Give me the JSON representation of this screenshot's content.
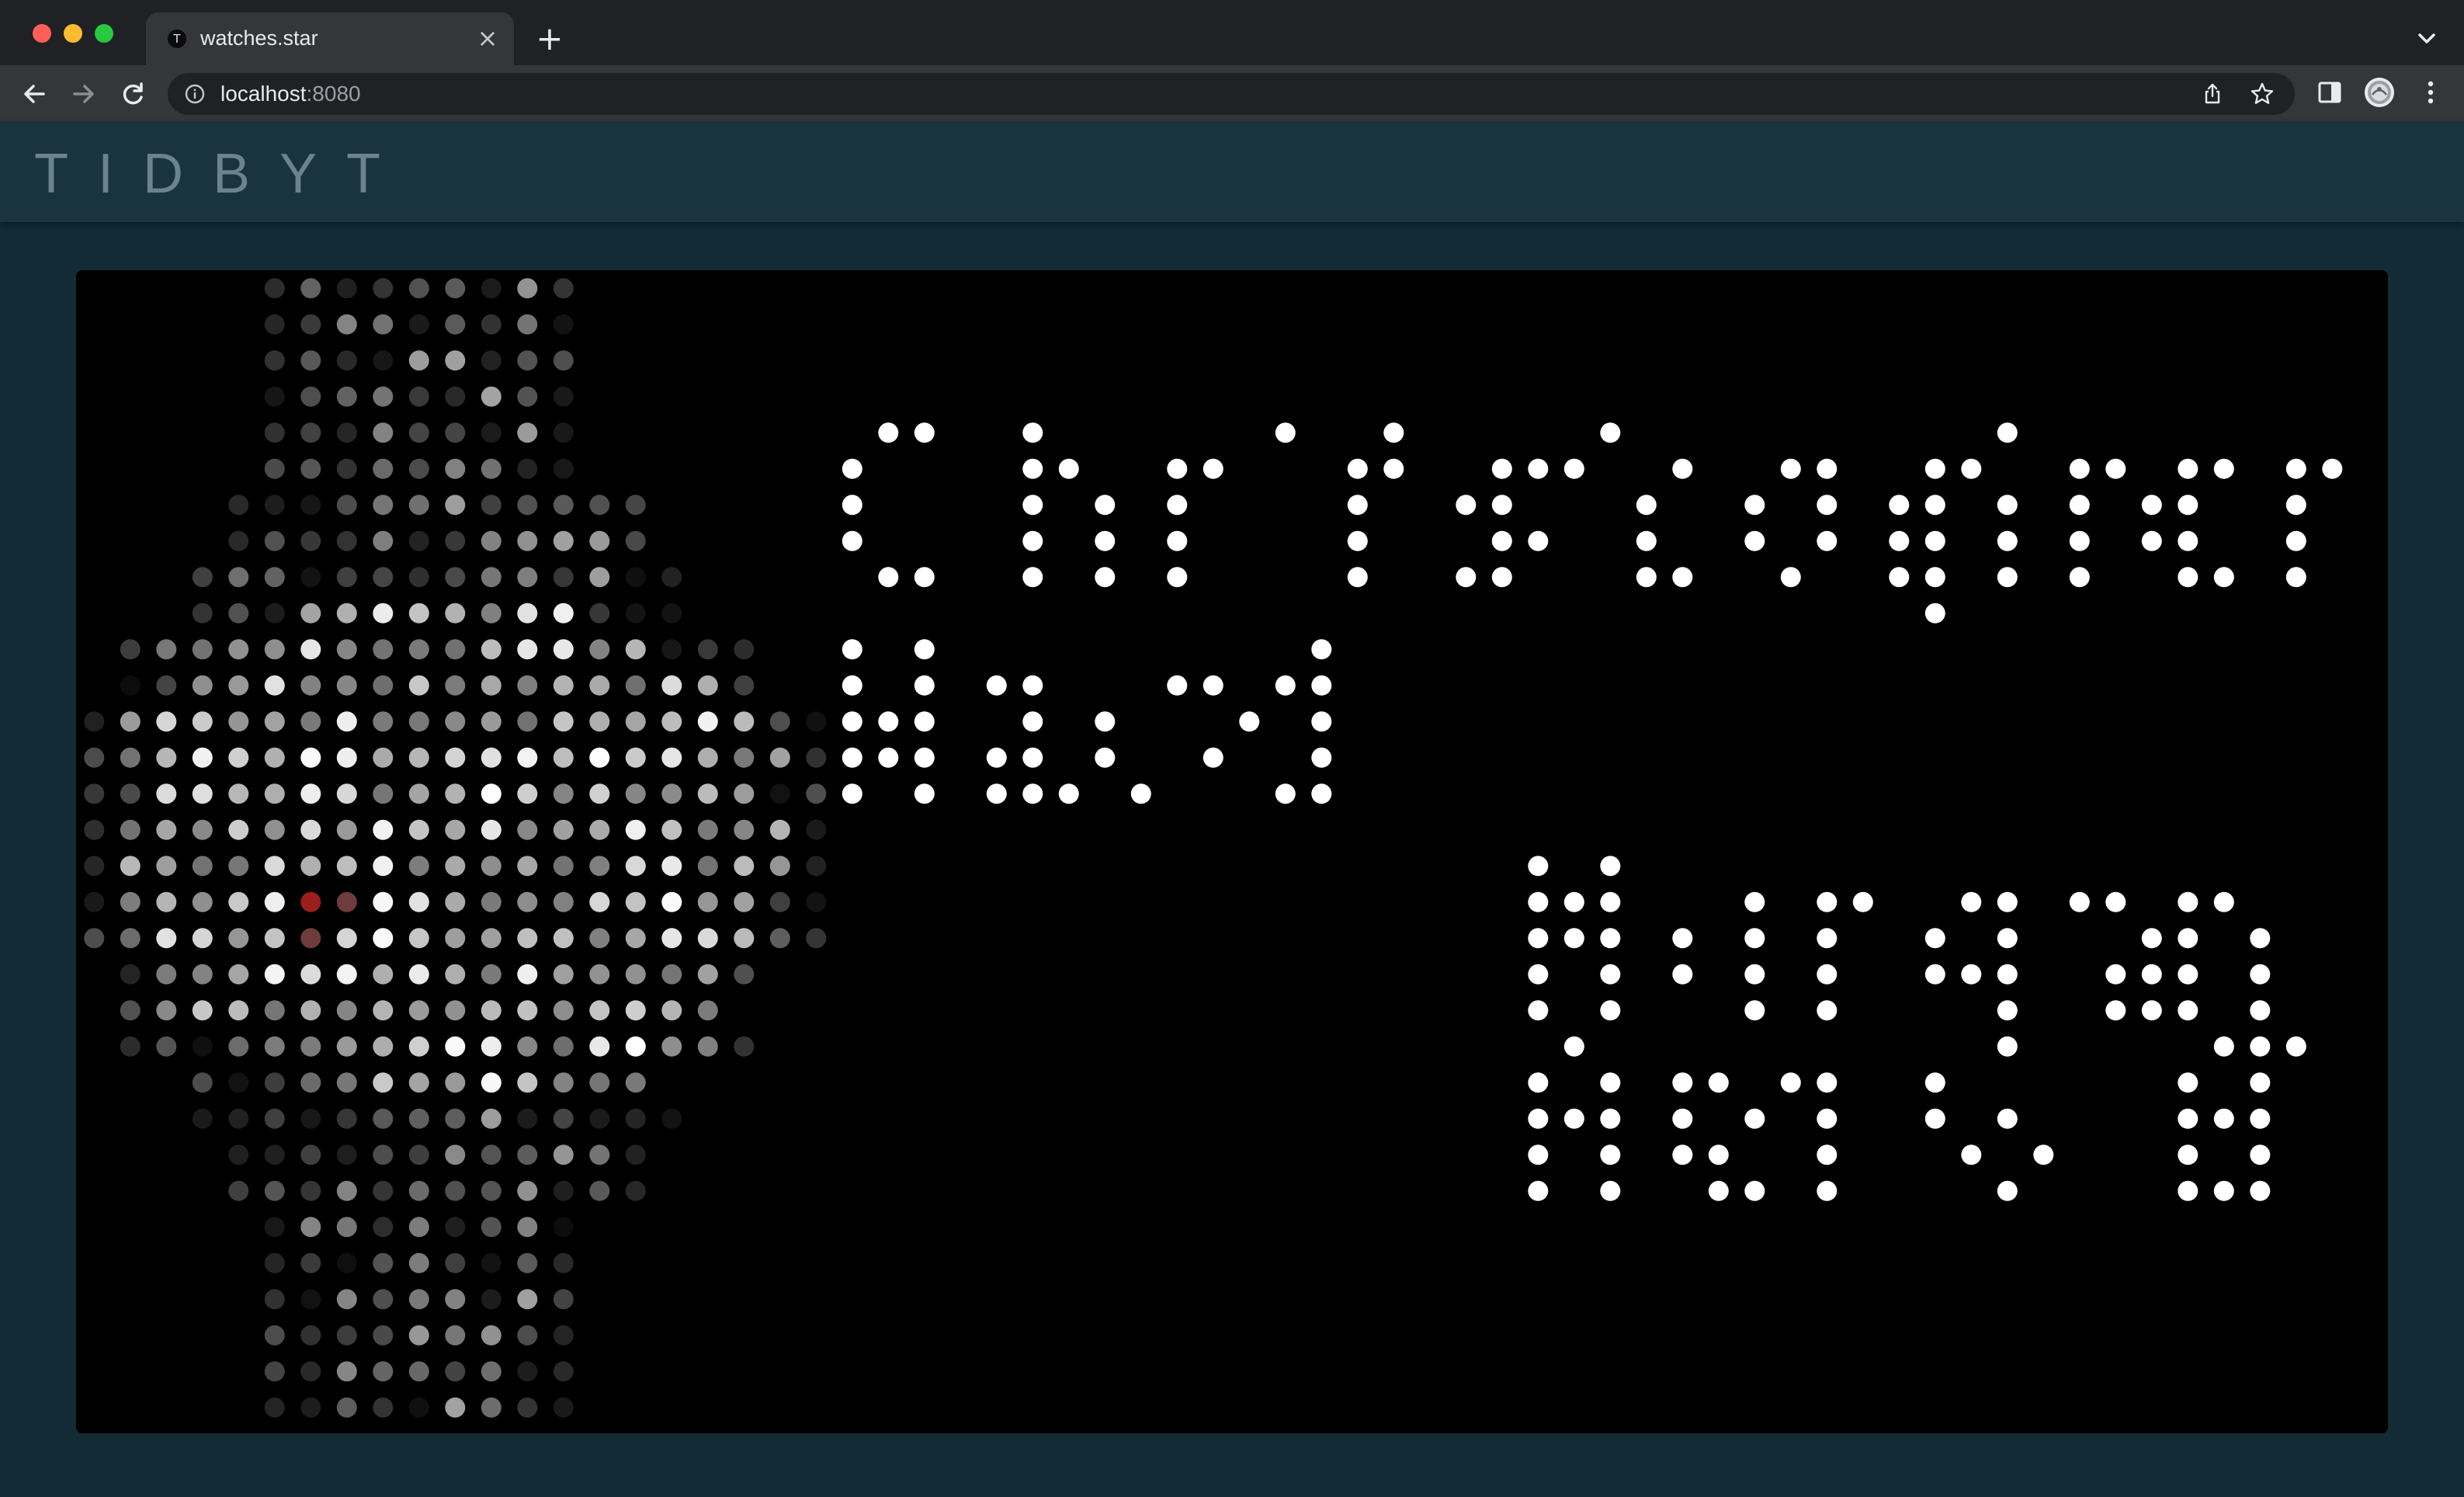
{
  "browser": {
    "tab_title": "watches.star",
    "favicon_letter": "T",
    "url_host": "localhost",
    "url_port": ":8080"
  },
  "app": {
    "logo": "TIDBYT"
  },
  "display": {
    "text_lines": [
      "Christopher",
      "Ward",
      "Morgan",
      "Aero 8"
    ],
    "text_color": "#ffffff",
    "image_subject": "watch"
  }
}
